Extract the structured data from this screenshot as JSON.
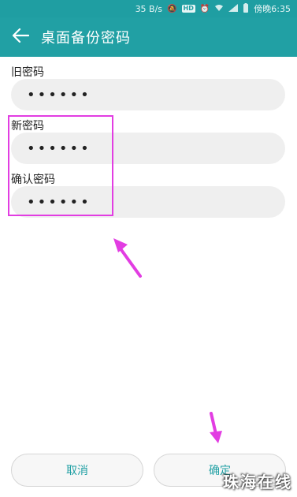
{
  "status_bar": {
    "network_speed": "35 B/s",
    "hd_badge": "HD",
    "carrier_time": "傍晚6:35"
  },
  "app_bar": {
    "title": "桌面备份密码",
    "back_icon": "back-arrow-icon"
  },
  "form": {
    "old_password": {
      "label": "旧密码",
      "value": "••••••"
    },
    "new_password": {
      "label": "新密码",
      "value": "••••••"
    },
    "confirm_password": {
      "label": "确认密码",
      "value": "••••••"
    }
  },
  "buttons": {
    "cancel_label": "取消",
    "confirm_label": "确定"
  },
  "annotations": {
    "highlight_color": "#e23de2",
    "arrow_color": "#e23de2"
  },
  "watermark": "珠海在线",
  "theme": {
    "accent": "#21a0a4",
    "status_bar": "#1f9ea2",
    "input_bg": "#efefef"
  }
}
